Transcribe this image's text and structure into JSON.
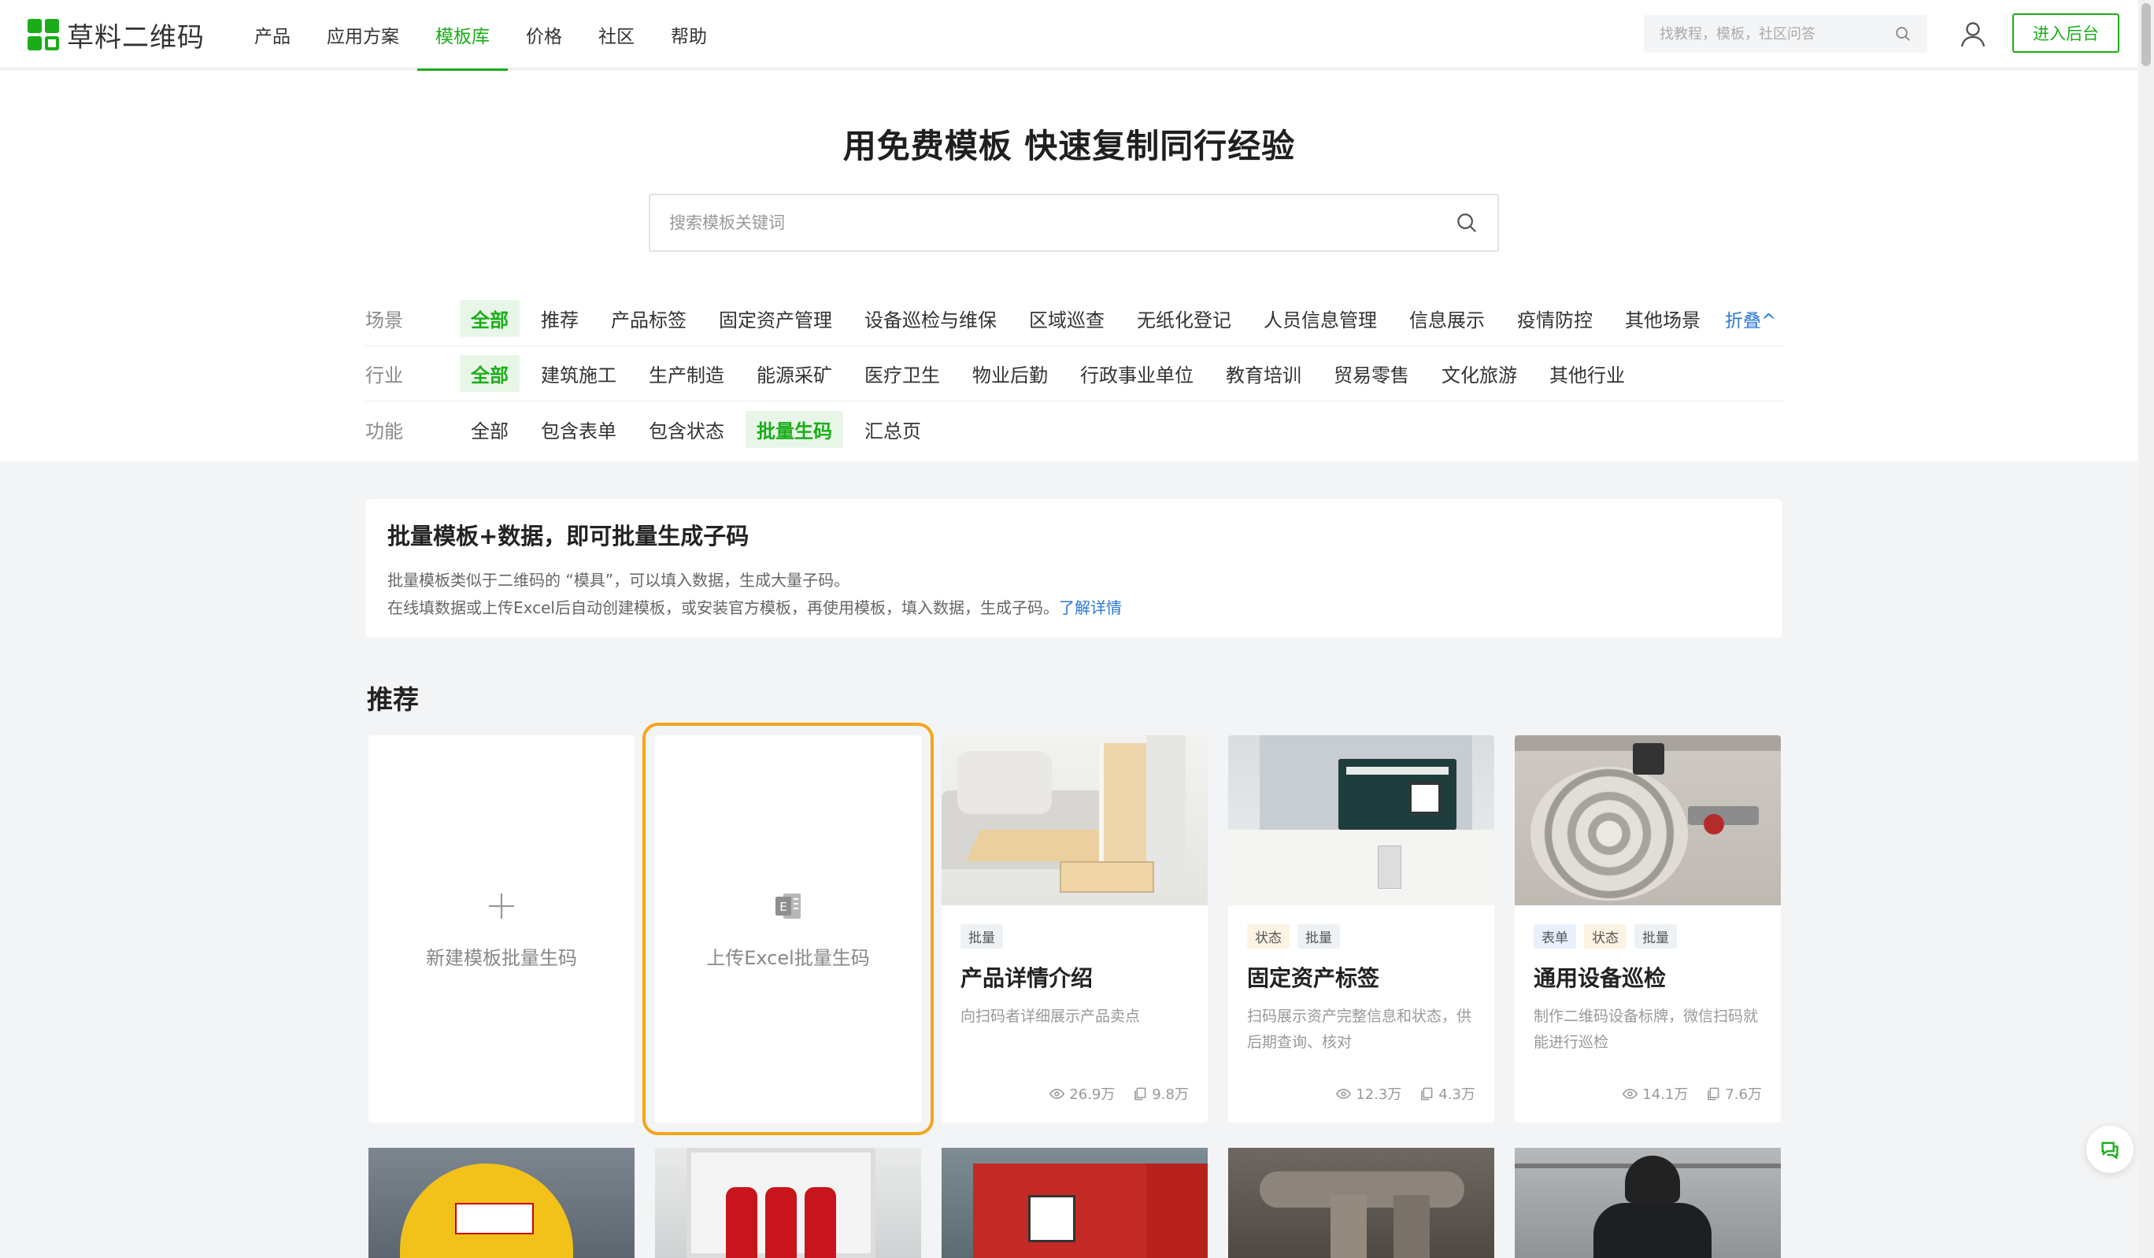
{
  "brand": {
    "name": "草料二维码",
    "colors": {
      "primary": "#1aad19",
      "link": "#2a79d6",
      "highlight": "#f5a518"
    }
  },
  "nav": {
    "items": [
      {
        "label": "产品"
      },
      {
        "label": "应用方案"
      },
      {
        "label": "模板库"
      },
      {
        "label": "价格"
      },
      {
        "label": "社区"
      },
      {
        "label": "帮助"
      }
    ],
    "active_label": "模板库"
  },
  "header": {
    "search_placeholder": "找教程，模板，社区问答",
    "admin_button": "进入后台"
  },
  "hero": {
    "title": "用免费模板 快速复制同行经验",
    "search_placeholder": "搜索模板关键词"
  },
  "filters": {
    "scene": {
      "label": "场景",
      "options": [
        "全部",
        "推荐",
        "产品标签",
        "固定资产管理",
        "设备巡检与维保",
        "区域巡查",
        "无纸化登记",
        "人员信息管理",
        "信息展示",
        "疫情防控",
        "其他场景"
      ],
      "active": "全部",
      "toggle": "折叠^"
    },
    "industry": {
      "label": "行业",
      "options": [
        "全部",
        "建筑施工",
        "生产制造",
        "能源采矿",
        "医疗卫生",
        "物业后勤",
        "行政事业单位",
        "教育培训",
        "贸易零售",
        "文化旅游",
        "其他行业"
      ],
      "active": "全部"
    },
    "function": {
      "label": "功能",
      "options": [
        "全部",
        "包含表单",
        "包含状态",
        "批量生码",
        "汇总页"
      ],
      "active": "批量生码"
    }
  },
  "info": {
    "title": "批量模板+数据，即可批量生成子码",
    "line1": "批量模板类似于二维码的 “模具”，可以填入数据，生成大量子码。",
    "line2": "在线填数据或上传Excel后自动创建模板，或安装官方模板，再使用模板，填入数据，生成子码。",
    "link": "了解详情"
  },
  "section": {
    "title": "推荐"
  },
  "actions": [
    {
      "label": "新建模板批量生码",
      "icon": "plus-icon"
    },
    {
      "label": "上传Excel批量生码",
      "icon": "excel-file-icon"
    }
  ],
  "templates": [
    {
      "tags": [
        {
          "text": "批量",
          "kind": "batch"
        }
      ],
      "title": "产品详情介绍",
      "desc": "向扫码者详细展示产品卖点",
      "views": "26.9万",
      "copies": "9.8万",
      "image": "sofa-photo"
    },
    {
      "tags": [
        {
          "text": "状态",
          "kind": "status"
        },
        {
          "text": "批量",
          "kind": "batch"
        }
      ],
      "title": "固定资产标签",
      "desc": "扫码展示资产完整信息和状态，供后期查询、核对",
      "views": "12.3万",
      "copies": "4.3万",
      "image": "machine-label-photo"
    },
    {
      "tags": [
        {
          "text": "表单",
          "kind": "form"
        },
        {
          "text": "状态",
          "kind": "status"
        },
        {
          "text": "批量",
          "kind": "batch"
        }
      ],
      "title": "通用设备巡检",
      "desc": "制作二维码设备标牌，微信扫码就能进行巡检",
      "views": "14.1万",
      "copies": "7.6万",
      "image": "fire-hose-photo"
    }
  ],
  "bottom_row_images": [
    "safety-helmet-photo",
    "fire-extinguisher-photo",
    "red-electric-box-photo",
    "industrial-pipes-photo",
    "security-guard-photo"
  ]
}
